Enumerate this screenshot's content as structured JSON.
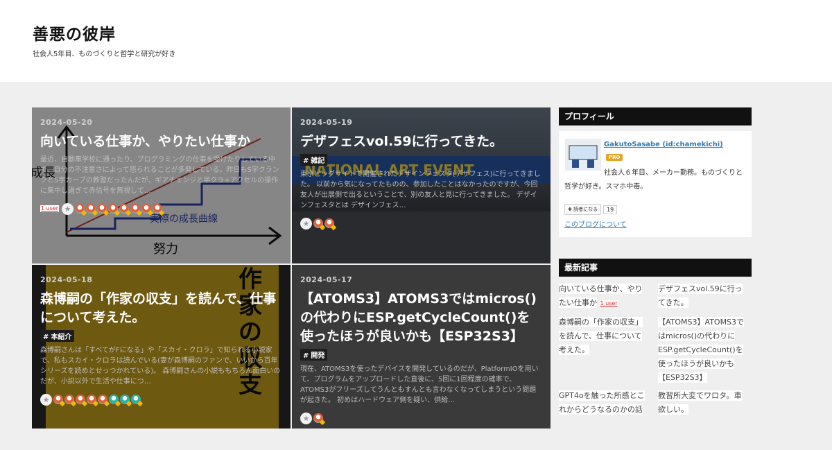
{
  "header": {
    "title": "善悪の彼岸",
    "description": "社会人5年目、ものづくりと哲学と研究が好き"
  },
  "entries": [
    {
      "date": "2024-05-20",
      "title": "向いている仕事か、やりたい仕事か",
      "category": "",
      "excerpt": "最近、自動車学校に通ったり、プログラミングの仕事を受けたりしている中で、自分の不注意さによって怒られることが多発している。昨日もS字クランクとS字カーブの教習だったんだが、ギアチェンジと半クラ+アクセルの操作に集中し過ぎて赤信号を無視して…",
      "bookmark_users": "1 user",
      "image_graph_labels": [
        "成長",
        "実際の成長曲線",
        "努力"
      ]
    },
    {
      "date": "2024-05-19",
      "title": "デザフェスvol.59に行ってきた。",
      "category": "雑記",
      "excerpt": "東京ビッグサイトで開催されたデザインフェスタ(デザフェス)に行ってきました。 以前から気になってたものの、参加したことはなかったのですが、今回友人が出展側で出るということで、別の友人と見に行ってきました。 デザインフェスタとは デザインフェス…",
      "image_sign": "NATIONAL ART EVENT"
    },
    {
      "date": "2024-05-18",
      "title": "森博嗣の「作家の収支」を読んで、仕事について考えた。",
      "category": "本紹介",
      "excerpt": "森博嗣さんは「すべてがFになる」や「スカイ・クロラ」で知られる小説家で、私もスカイ・クロラは読んでいる(妻が森博嗣のファンで、いいから百年シリーズを読めとせっつかれている)。 森博嗣さんの小説ももちろん面白いのだが、小説以外で生活や仕事につ…",
      "image_book_title": "作家の収支"
    },
    {
      "date": "2024-05-17",
      "title": "【ATOMS3】ATOMS3ではmicros()の代わりにESP.getCycleCount()を使ったほうが良いかも【ESP32S3】",
      "category": "開発",
      "excerpt": "現在、ATOMS3を使ったデバイスを開発しているのだが、PlatformIOを用いて、プログラムをアップロードした直後に、5回に1回程度の確率で、ATOMS3がフリーズしてうんともすんとも言わなくなってしまうという問題が起きた。 初めはハードウェア側を疑い、供給…"
    }
  ],
  "sidebar": {
    "profile": {
      "heading": "プロフィール",
      "name": "GakutoSasabe (id:chamekichi)",
      "badge": "PRO",
      "intro": "社会人６年目、メーカー勤務。ものづくりと哲学が好き。スマホ中毒。",
      "reader_button": "読者になる",
      "reader_count": "19",
      "about_link": "このブログについて"
    },
    "recent": {
      "heading": "最新記事",
      "items": [
        {
          "title": "向いている仕事か、やりたい仕事か",
          "users": "1 user"
        },
        {
          "title": "デザフェスvol.59に行ってきた。"
        },
        {
          "title": "森博嗣の「作家の収支」を読んで、仕事について考えた。"
        },
        {
          "title": "【ATOMS3】ATOMS3ではmicros()の代わりにESP.getCycleCount()を使ったほうが良いかも【ESP32S3】"
        },
        {
          "title": "GPT4oを触った所感とこれからどうなるのかの話"
        },
        {
          "title": "教習所大変でワロタ。車欲しい。"
        }
      ]
    }
  },
  "colors": {
    "accent_link": "#2a7ab8",
    "pro_badge": "#e8a323",
    "module_header": "#111111",
    "book_cover": "#c9a21e"
  }
}
